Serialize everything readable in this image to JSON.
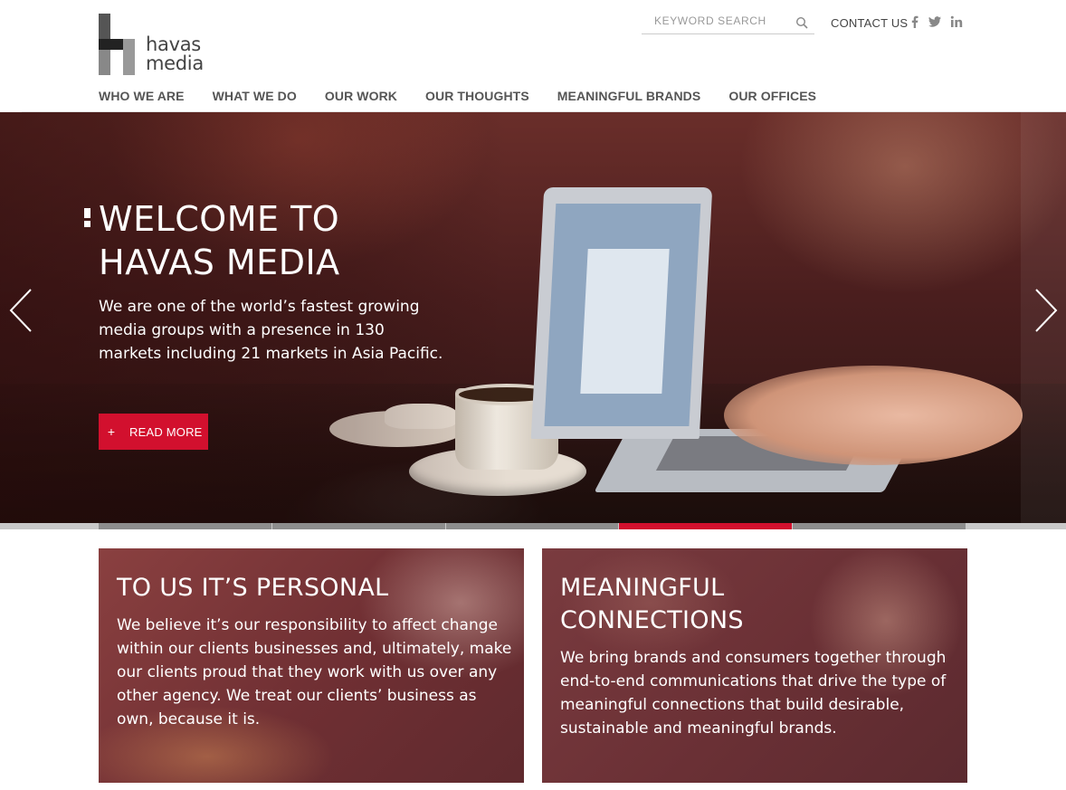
{
  "brand": {
    "name_line1": "havas",
    "name_line2": "media"
  },
  "search": {
    "placeholder": "KEYWORD SEARCH",
    "value": ""
  },
  "header": {
    "contact_label": "CONTACT US"
  },
  "social": [
    "facebook-icon",
    "twitter-icon",
    "linkedin-icon"
  ],
  "nav": {
    "items": [
      {
        "label": "WHO WE ARE"
      },
      {
        "label": "WHAT WE DO"
      },
      {
        "label": "OUR WORK"
      },
      {
        "label": "OUR THOUGHTS"
      },
      {
        "label": "MEANINGFUL BRANDS"
      },
      {
        "label": "OUR OFFICES"
      }
    ]
  },
  "hero": {
    "title_line1": "WELCOME TO",
    "title_line2": "HAVAS MEDIA",
    "text": "We are one of the world’s fastest growing media groups with a presence in 130 markets including 21 markets in Asia Pacific.",
    "cta_icon": "+",
    "cta_label": "READ MORE",
    "slides_total": 5,
    "active_slide": 4
  },
  "colors": {
    "accent": "#d2102e",
    "slider_inactive": "#8d8d8d",
    "nav_text": "#555555"
  },
  "cards": [
    {
      "title_lines": [
        "TO US IT’S PERSONAL"
      ],
      "text": "We believe it’s our responsibility to affect change within our clients businesses and, ultimately, make our clients proud that they work with us over any other agency. We treat our clients’ business as own, because it is."
    },
    {
      "title_lines": [
        "MEANINGFUL",
        "CONNECTIONS"
      ],
      "text": "We bring brands and consumers together through end-to-end communications that drive the type of meaningful connections that build desirable, sustainable and meaningful brands."
    }
  ]
}
